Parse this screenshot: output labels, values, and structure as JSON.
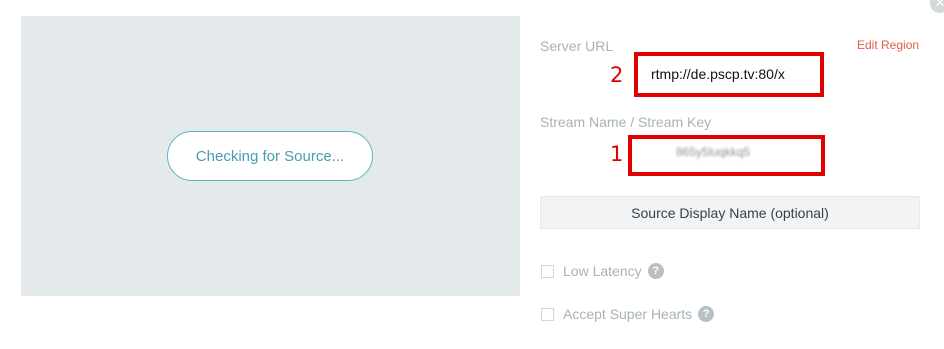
{
  "close": {
    "glyph": "✕"
  },
  "preview": {
    "status_label": "Checking for Source..."
  },
  "server": {
    "label": "Server URL",
    "edit_region": "Edit Region",
    "url_value": "rtmp://de.pscp.tv:80/x"
  },
  "stream": {
    "label": "Stream Name / Stream Key",
    "key_value": "865y5luqkkq5"
  },
  "annotations": {
    "url_number": "2",
    "key_number": "1"
  },
  "display_name": {
    "placeholder": "Source Display Name (optional)"
  },
  "options": {
    "low_latency": {
      "label": "Low Latency",
      "help": "?"
    },
    "super_hearts": {
      "label": "Accept Super Hearts",
      "help": "?"
    }
  },
  "colors": {
    "annotation_red": "#e00000",
    "accent_teal": "#5ab4c9",
    "edit_region_red": "#e05a4e"
  }
}
